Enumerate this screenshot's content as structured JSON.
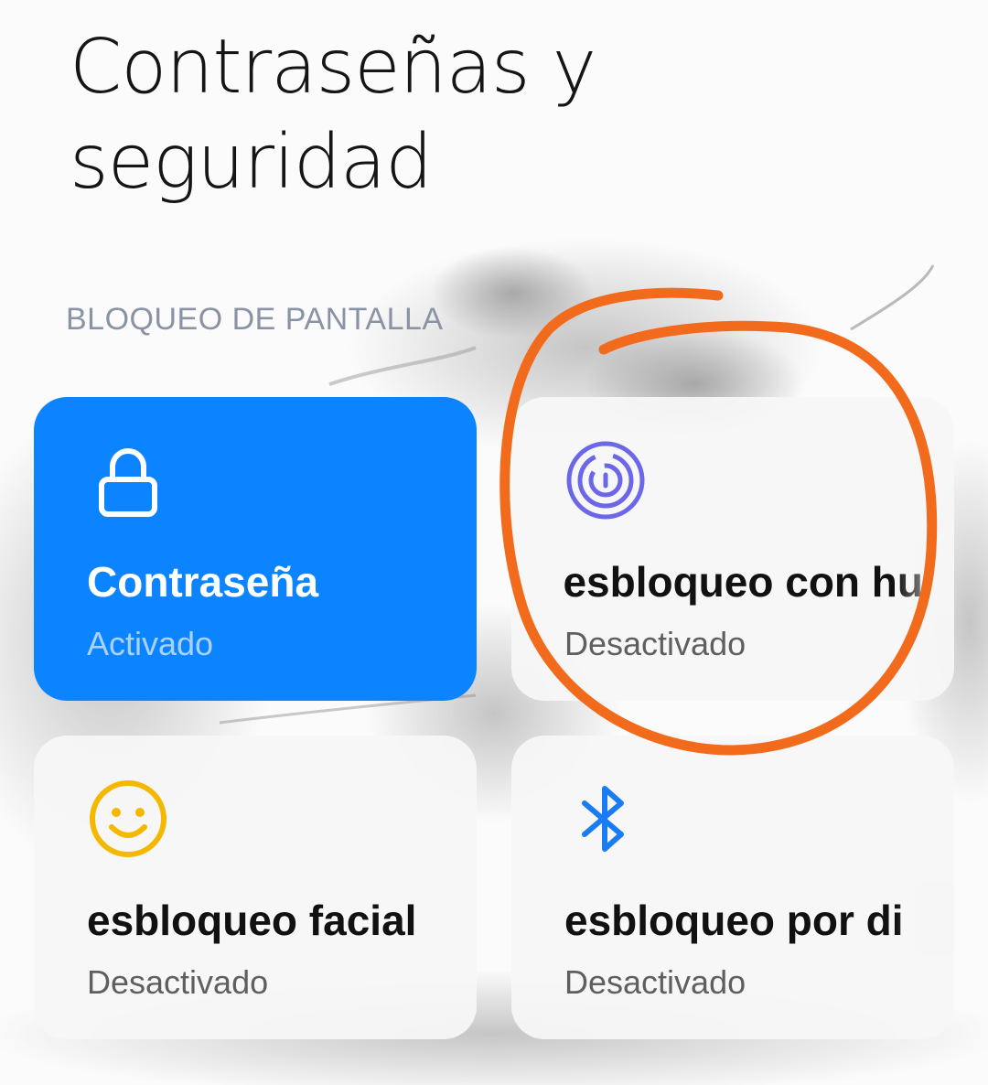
{
  "header": {
    "title_line1": "Contraseñas y",
    "title_line2": "seguridad"
  },
  "section": {
    "title": "BLOQUEO DE PANTALLA"
  },
  "cards": [
    {
      "label": "Contraseña",
      "status": "Activado",
      "icon": "lock-icon",
      "active": true
    },
    {
      "label": "esbloqueo con hu",
      "status": "Desactivado",
      "icon": "fingerprint-icon",
      "active": false
    },
    {
      "label": "esbloqueo facial",
      "status": "Desactivado",
      "icon": "face-icon",
      "active": false
    },
    {
      "label": "esbloqueo por di",
      "status": "Desactivado",
      "icon": "bluetooth-icon",
      "active": false
    }
  ],
  "colors": {
    "active_card": "#0d84ff",
    "fingerprint_icon": "#6b67e8",
    "face_icon": "#f5b800",
    "bluetooth_icon": "#1a7cf2",
    "annotation_circle": "#f26b1d"
  }
}
